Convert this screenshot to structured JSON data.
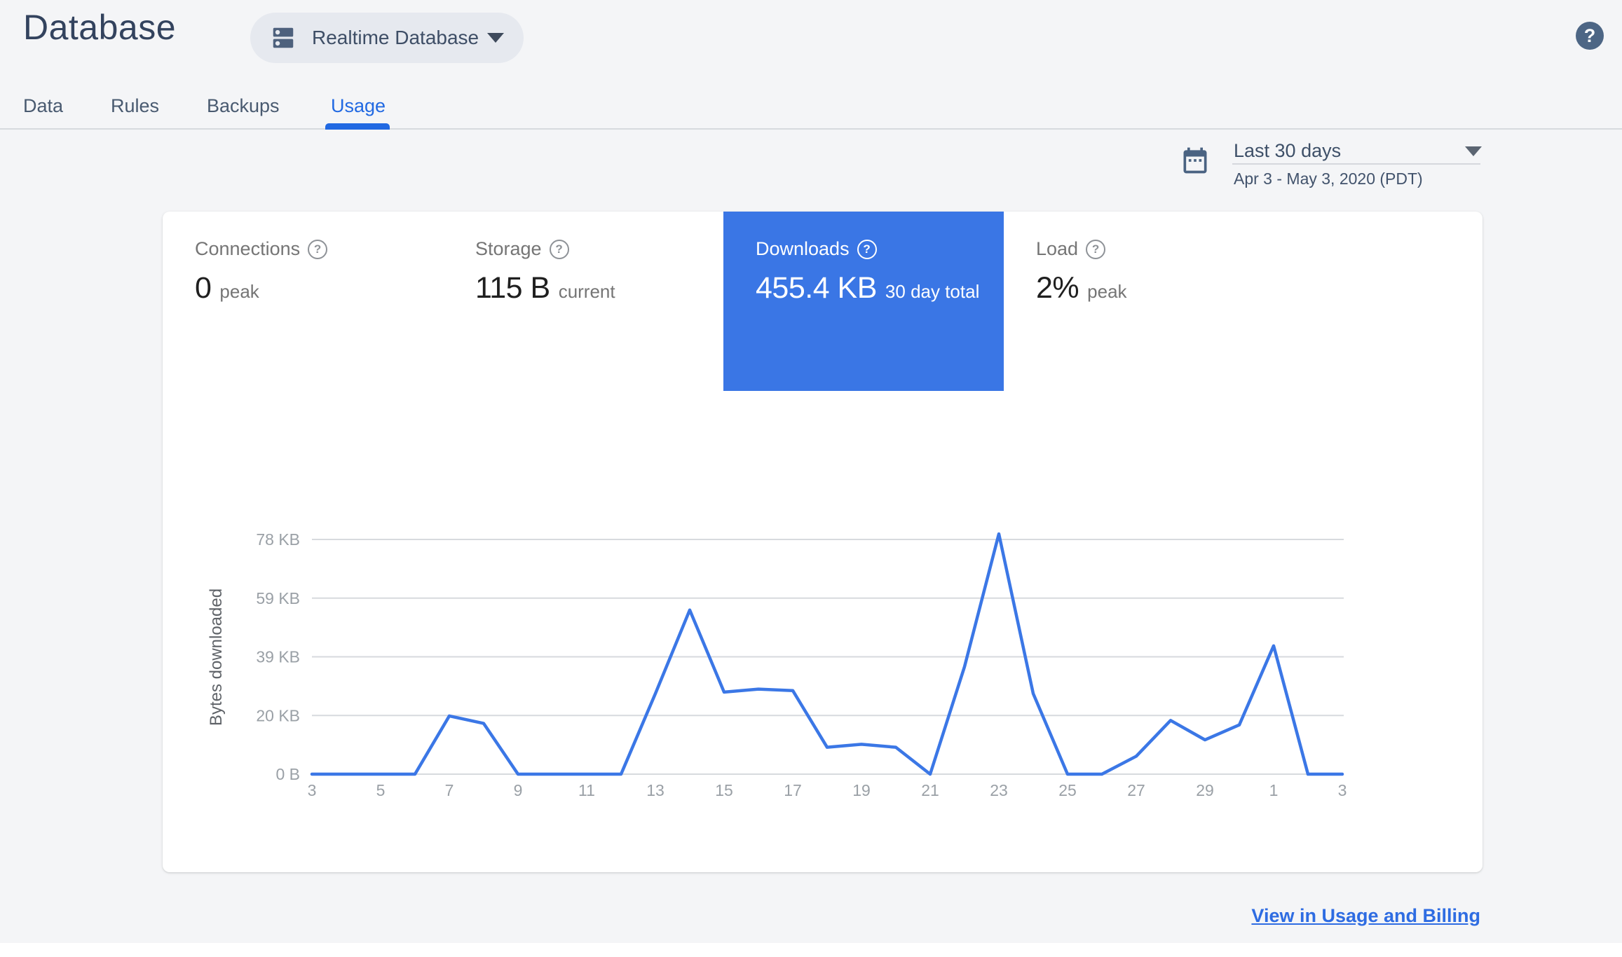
{
  "header": {
    "title": "Database",
    "database_selector_label": "Realtime Database",
    "help_glyph": "?"
  },
  "tabs": [
    {
      "label": "Data",
      "active": false
    },
    {
      "label": "Rules",
      "active": false
    },
    {
      "label": "Backups",
      "active": false
    },
    {
      "label": "Usage",
      "active": true
    }
  ],
  "date_selector": {
    "preset": "Last 30 days",
    "range": "Apr 3 - May 3, 2020 (PDT)"
  },
  "icons": {
    "help_glyph": "?"
  },
  "metrics": [
    {
      "label": "Connections",
      "value": "0",
      "suffix": "peak",
      "selected": false
    },
    {
      "label": "Storage",
      "value": "115 B",
      "suffix": "current",
      "selected": false
    },
    {
      "label": "Downloads",
      "value": "455.4 KB",
      "suffix": "30 day total",
      "selected": true
    },
    {
      "label": "Load",
      "value": "2%",
      "suffix": "peak",
      "selected": false
    }
  ],
  "chart_data": {
    "type": "line",
    "title": "",
    "xlabel": "",
    "ylabel": "Bytes downloaded",
    "x_days": [
      3,
      4,
      5,
      6,
      7,
      8,
      9,
      10,
      11,
      12,
      13,
      14,
      15,
      16,
      17,
      18,
      19,
      20,
      21,
      22,
      23,
      24,
      25,
      26,
      27,
      28,
      29,
      30,
      1,
      2,
      3
    ],
    "values_kb": [
      0,
      0,
      0,
      0,
      19.5,
      17,
      0,
      0,
      0,
      0,
      27,
      55,
      27.5,
      28.5,
      28,
      9,
      10,
      9,
      0,
      36,
      80.5,
      27,
      0,
      0,
      6,
      18,
      11.5,
      16.5,
      43,
      0,
      0
    ],
    "x_tick_labels": [
      "3",
      "5",
      "7",
      "9",
      "11",
      "13",
      "15",
      "17",
      "19",
      "21",
      "23",
      "25",
      "27",
      "29",
      "1",
      "3"
    ],
    "y_ticks": [
      {
        "label": "0 B",
        "value_kb": 0
      },
      {
        "label": "20 KB",
        "value_kb": 19.66
      },
      {
        "label": "39 KB",
        "value_kb": 39.32
      },
      {
        "label": "59 KB",
        "value_kb": 58.98
      },
      {
        "label": "78 KB",
        "value_kb": 78.64
      }
    ],
    "ylim_kb": [
      0,
      82
    ],
    "grid": "horizontal",
    "legend": false,
    "line_color": "#3b77e6",
    "grid_color": "#d7dade",
    "tick_color": "#9aa0a6",
    "axis_title_color": "#5f6368"
  },
  "footer": {
    "link_label": "View in Usage and Billing"
  },
  "colors": {
    "page_bg": "#f4f5f7",
    "accent_blue": "#2169e2",
    "selected_tile_bg": "#3a76e5",
    "slate": "#33435e"
  }
}
